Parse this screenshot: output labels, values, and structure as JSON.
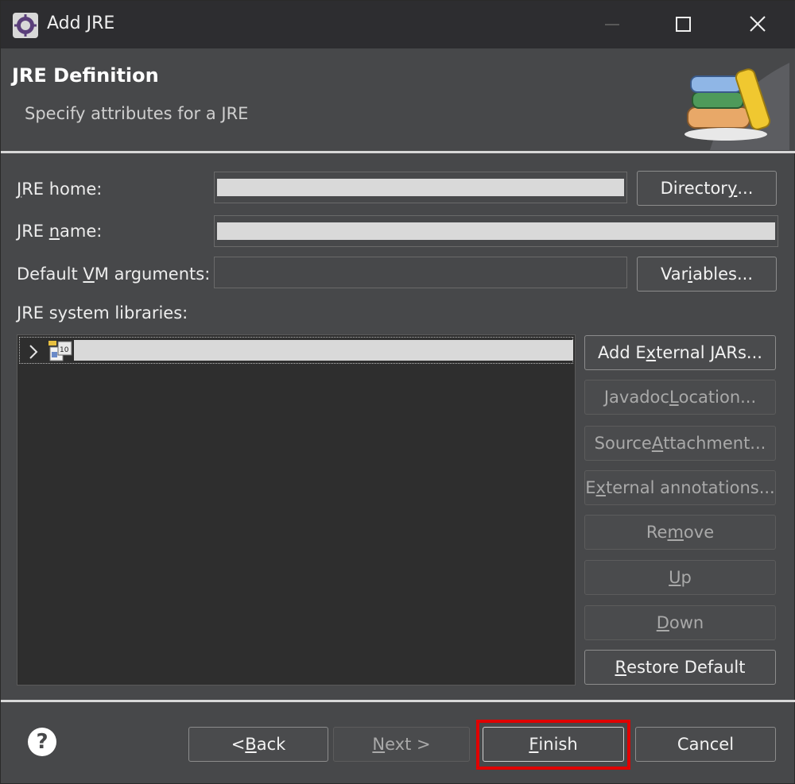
{
  "window": {
    "title": "Add JRE",
    "controls": {
      "minimize": "—",
      "maximize": "☐",
      "close": "✕"
    }
  },
  "header": {
    "title": "JRE Definition",
    "subtitle": "Specify attributes for a JRE"
  },
  "form": {
    "jre_home": {
      "label": "JRE home:",
      "value": ""
    },
    "jre_name": {
      "label": "JRE name:",
      "value": ""
    },
    "vm_args": {
      "label": "Default VM arguments:",
      "value": ""
    },
    "directory_button": "Directory...",
    "variables_button": "Variables...",
    "libraries_label": "JRE system libraries:"
  },
  "libraries": {
    "items": [
      {
        "label": "",
        "icon": "jar-library-icon"
      }
    ]
  },
  "library_buttons": {
    "add_external_jars": "Add External JARs...",
    "javadoc_location": "Javadoc Location...",
    "source_attachment": "Source Attachment...",
    "external_annotations": "External annotations...",
    "remove": "Remove",
    "up": "Up",
    "down": "Down",
    "restore_default": "Restore Default"
  },
  "footer": {
    "help": "?",
    "back": "< Back",
    "next": "Next >",
    "finish": "Finish",
    "cancel": "Cancel"
  },
  "colors": {
    "window_bg": "#47484a",
    "titlebar_bg": "#2d2d30",
    "tree_bg": "#2e2e2e",
    "highlight": "#e00000"
  }
}
